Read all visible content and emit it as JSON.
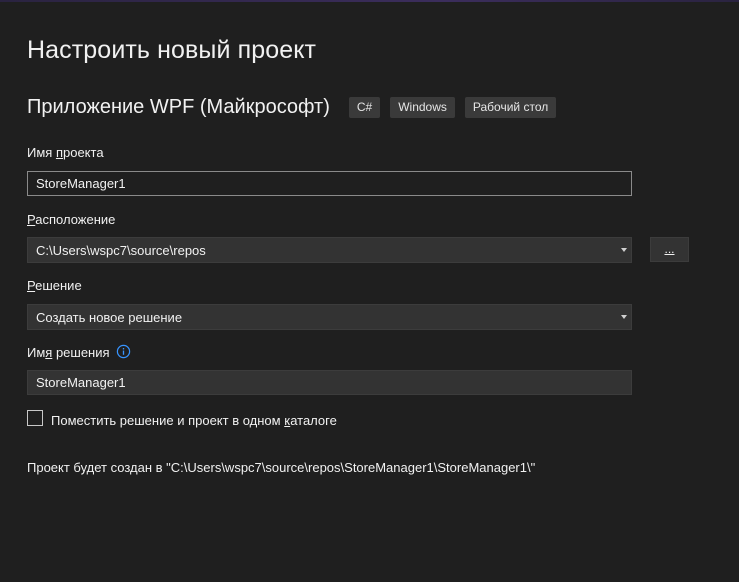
{
  "dialog": {
    "title": "Настроить новый проект"
  },
  "template": {
    "name": "Приложение WPF (Майкрософт)",
    "tags": [
      "C#",
      "Windows",
      "Рабочий стол"
    ]
  },
  "project_name": {
    "label_accel": "Имя ",
    "label_rest_underlined": "п",
    "label_tail": "роекта",
    "value": "StoreManager1"
  },
  "location": {
    "label_accel": "Р",
    "label_tail": "асположение",
    "value": "C:\\Users\\wspc7\\source\\repos",
    "browse_label": "..."
  },
  "solution": {
    "label_accel": "Р",
    "label_tail": "ешение",
    "selected": "Создать новое решение"
  },
  "solution_name": {
    "label_head": "Им",
    "label_accel": "я",
    "label_tail": " решения",
    "value": "StoreManager1",
    "info_icon": "info-icon"
  },
  "same_directory": {
    "checked": false,
    "label_head": "Поместить решение и проект в одном ",
    "label_accel": "к",
    "label_tail": "аталоге"
  },
  "path_note": "Проект будет создан в \"C:\\Users\\wspc7\\source\\repos\\StoreManager1\\StoreManager1\\\"",
  "colors": {
    "background": "#1f1f1f",
    "control": "#333333",
    "text": "#f1f1f1",
    "info_blue": "#3794ff"
  }
}
